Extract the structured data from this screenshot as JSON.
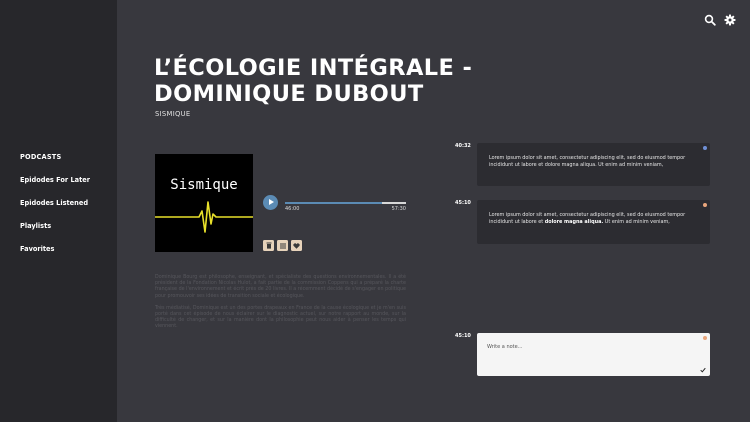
{
  "sidebar": {
    "items": [
      {
        "label": "PODCASTS"
      },
      {
        "label": "Epidodes For Later"
      },
      {
        "label": "Epidodes Listened"
      },
      {
        "label": "Playlists"
      },
      {
        "label": "Favorites"
      }
    ]
  },
  "header": {
    "icons": [
      "search-icon",
      "gear-icon"
    ]
  },
  "episode": {
    "title_line1": "L’ÉCOLOGIE INTÉGRALE -",
    "title_line2": "DOMINIQUE DUBOUT",
    "podcast": "SISMIQUE",
    "cover_text": "Sismique",
    "description": [
      "Dominique Bourg est philosophe, enseignant, et spécialiste des questions environnementales. Il a été président de la Fondation Nicolas Hulot, a fait partie de la commission Coppens qui a préparé la charte française de l'environnement et écrit près de 20 livres. Il a récemment décidé de s'engager en politique pour promouvoir ses idées de transition sociale et écologique.",
      "Très médiatisé, Dominique est un des portes drapeaux en France de la cause écologique et je m'en suis porté dans cet épisode de nous éclairer sur le diagnostic actuel, sur notre rapport au monde, sur la difficulté de changer, et sur la manière dont la philosophie peut nous aider à penser les temps qui viennent."
    ]
  },
  "player": {
    "current_time": "46:00",
    "total_time": "57:30",
    "progress": 0.8,
    "accent": "#5b8bb4"
  },
  "actions": [
    "trash-icon",
    "list-icon",
    "heart-icon"
  ],
  "notes": [
    {
      "time": "40:32",
      "text_a": "Lorem ipsum dolor sit amet, consectetur adipiscing elit, sed do eiusmod tempor incididunt ut labore et dolore magna aliqua. Ut enim ad minim veniam,",
      "bold": "",
      "text_b": "",
      "dot_color": "#6f8fd6"
    },
    {
      "time": "45:10",
      "text_a": "Lorem ipsum dolor sit amet, consectetur adipiscing elit, sed do eiusmod tempor incididunt ut labore et ",
      "bold": "dolore magna aliqua.",
      "text_b": " Ut enim ad minim veniam,",
      "dot_color": "#e8a57c"
    }
  ],
  "editor": {
    "time": "45:10",
    "placeholder": "Write a note...",
    "dot_color": "#e8a57c"
  }
}
